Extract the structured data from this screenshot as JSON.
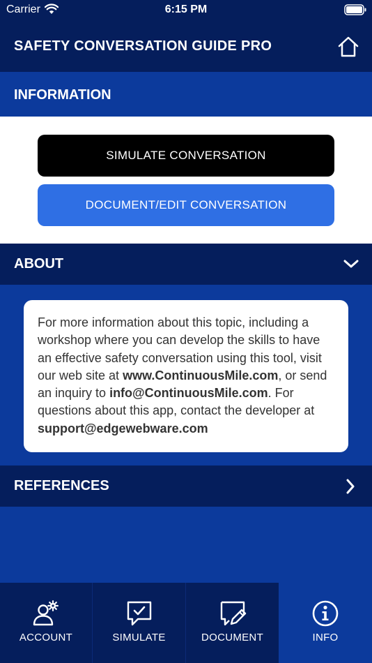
{
  "status_bar": {
    "carrier": "Carrier",
    "time": "6:15 PM"
  },
  "nav": {
    "title": "SAFETY CONVERSATION GUIDE PRO",
    "home_icon": "home-icon"
  },
  "information": {
    "title": "INFORMATION",
    "simulate_button": "SIMULATE CONVERSATION",
    "document_button": "DOCUMENT/EDIT CONVERSATION"
  },
  "about": {
    "title": "ABOUT",
    "text_1": "For more information about this topic, including a workshop where you can develop the skills to have an effective safety conversation using this tool, visit our web site at ",
    "website": "www.ContinuousMile.com",
    "text_2": ", or send an inquiry to ",
    "email": "info@ContinuousMile.com",
    "text_3": ". For questions about this app, contact the developer at ",
    "support_email": "support@edgewebware.com"
  },
  "references": {
    "title": "REFERENCES"
  },
  "tab_bar": {
    "tabs": [
      {
        "label": "ACCOUNT",
        "icon": "account-settings-icon"
      },
      {
        "label": "SIMULATE",
        "icon": "chat-check-icon"
      },
      {
        "label": "DOCUMENT",
        "icon": "chat-edit-icon"
      },
      {
        "label": "INFO",
        "icon": "info-icon"
      }
    ],
    "active": "INFO"
  },
  "colors": {
    "dark_navy": "#051e5c",
    "royal_blue": "#0c3a9c",
    "button_blue": "#2f6fe4",
    "button_black": "#000000"
  }
}
